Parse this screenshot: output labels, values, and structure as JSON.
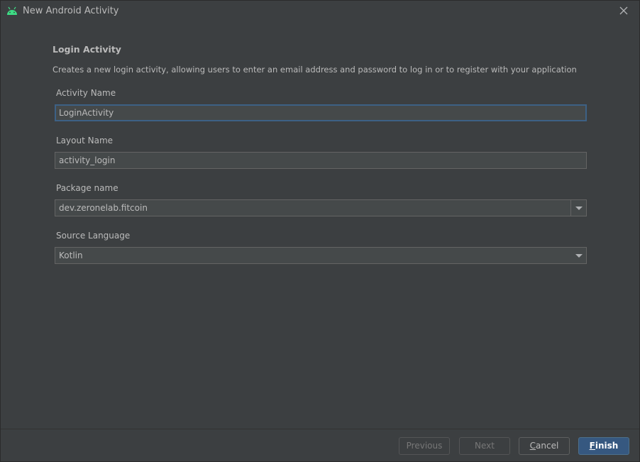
{
  "window": {
    "title": "New Android Activity",
    "icon": "android-icon",
    "close_icon": "close-icon"
  },
  "header": {
    "heading": "Login Activity",
    "description": "Creates a new login activity, allowing users to enter an email address and password to log in or to register with your application"
  },
  "form": {
    "activity_name": {
      "label": "Activity Name",
      "value": "LoginActivity"
    },
    "layout_name": {
      "label": "Layout Name",
      "value": "activity_login"
    },
    "package_name": {
      "label": "Package name",
      "value": "dev.zeronelab.fitcoin"
    },
    "source_language": {
      "label": "Source Language",
      "value": "Kotlin"
    }
  },
  "buttons": {
    "previous": "Previous",
    "next": "Next",
    "cancel_mnemonic": "C",
    "cancel_rest": "ancel",
    "finish_mnemonic": "F",
    "finish_rest": "inish"
  },
  "colors": {
    "background": "#3c3f41",
    "input_bg": "#45494a",
    "focus_border": "#3d6185",
    "primary_button": "#365880",
    "android_green": "#3ddc84"
  }
}
